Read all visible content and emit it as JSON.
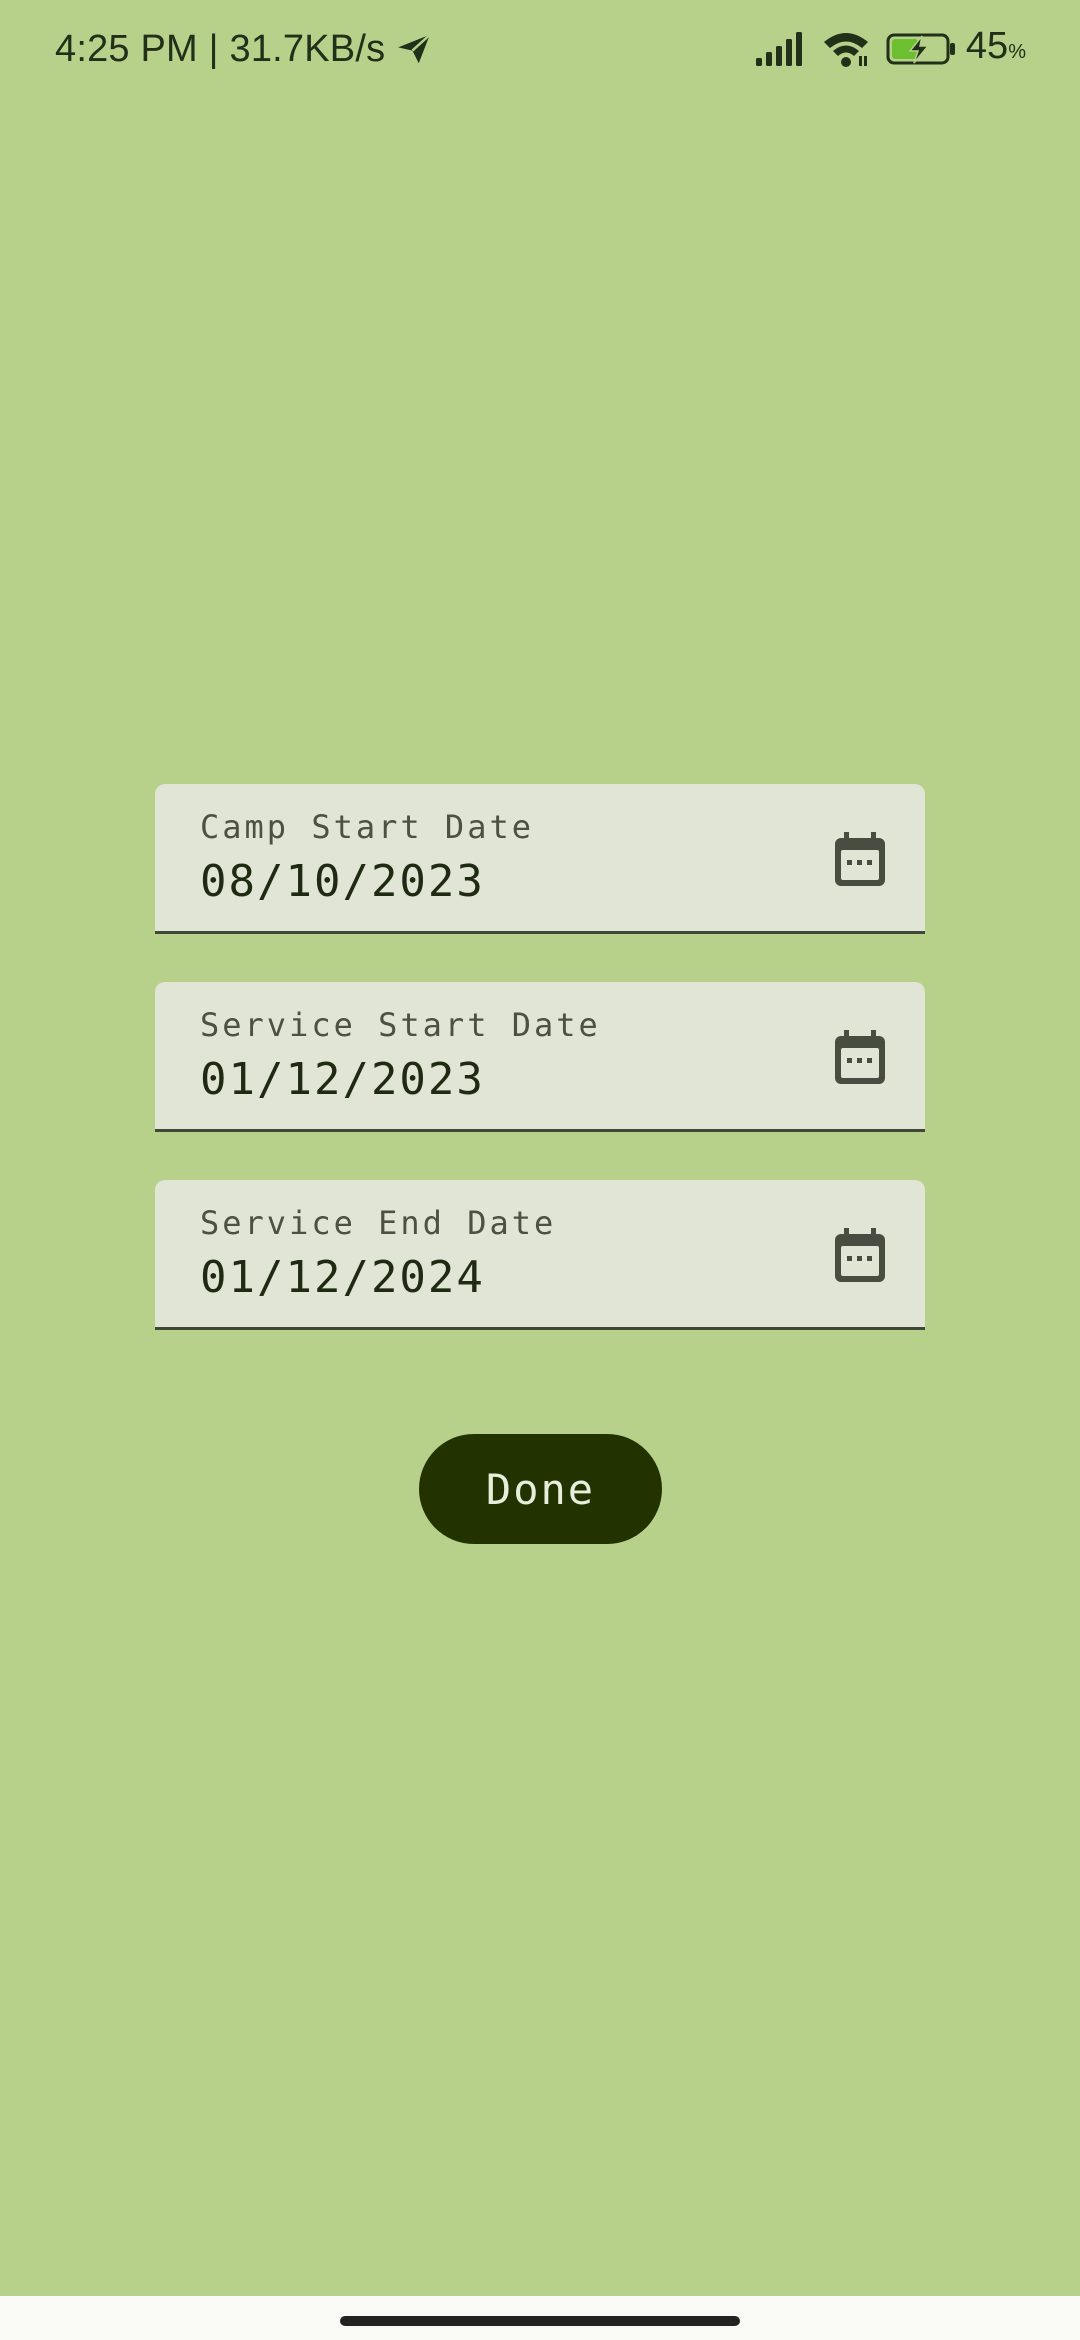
{
  "status_bar": {
    "time_speed": "4:25 PM | 31.7KB/s",
    "battery_percent": "45",
    "battery_unit": "%",
    "icons": [
      "telegram-send-icon",
      "signal-icon",
      "wifi-icon",
      "battery-charging-icon"
    ]
  },
  "form": {
    "fields": [
      {
        "label": "Camp Start Date",
        "value": "08/10/2023",
        "icon": "calendar-icon"
      },
      {
        "label": "Service Start Date",
        "value": "01/12/2023",
        "icon": "calendar-icon"
      },
      {
        "label": "Service End Date",
        "value": "01/12/2024",
        "icon": "calendar-icon"
      }
    ],
    "done_label": "Done"
  },
  "colors": {
    "background": "#b7d08a",
    "field_bg": "#e1e5d5",
    "button_bg": "#233300",
    "button_text": "#e8eedc"
  }
}
